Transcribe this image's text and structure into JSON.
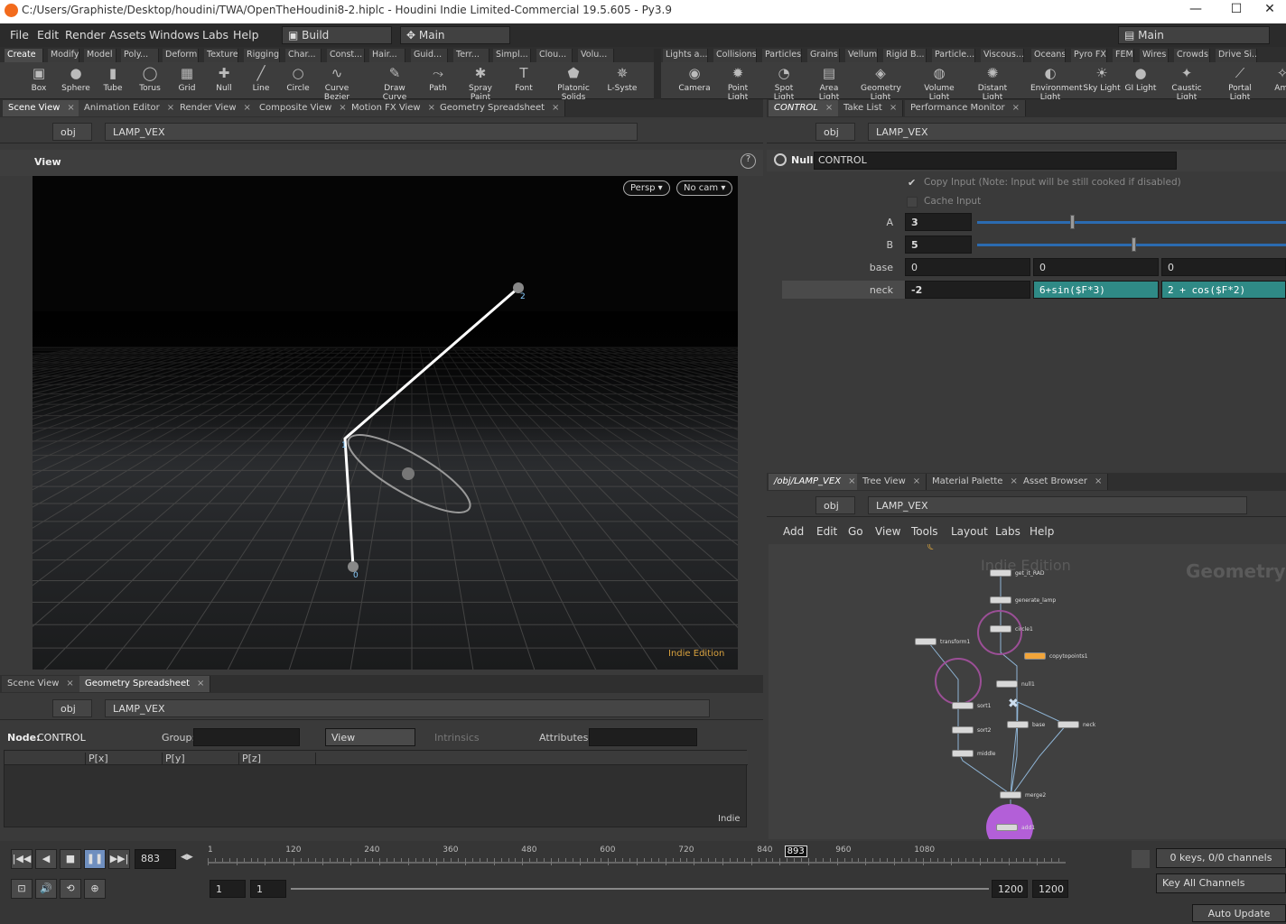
{
  "window": {
    "title": "C:/Users/Graphiste/Desktop/houdini/TWA/OpenTheHoudini8-2.hiplc - Houdini Indie Limited-Commercial 19.5.605 - Py3.9",
    "min": "—",
    "max": "☐",
    "close": "✕"
  },
  "menubar": {
    "items": [
      "File",
      "Edit",
      "Render",
      "Assets",
      "Windows",
      "Labs",
      "Help"
    ],
    "desktop": "Build",
    "context": "Main",
    "right_desktop": "Main"
  },
  "shelf_tabs_left": [
    "Create",
    "Modify",
    "Model",
    "Poly...",
    "Deform",
    "Texture",
    "Rigging",
    "Char...",
    "Const...",
    "Hair...",
    "Guid...",
    "Terr...",
    "Simpl...",
    "Clou...",
    "Volu..."
  ],
  "shelf_tabs_right": [
    "Lights a...",
    "Collisions",
    "Particles",
    "Grains",
    "Vellum",
    "Rigid B...",
    "Particle...",
    "Viscous...",
    "Oceans",
    "Pyro FX",
    "FEM",
    "Wires",
    "Crowds",
    "Drive Si..."
  ],
  "tools_left": [
    {
      "label": "Box",
      "icon": "▣"
    },
    {
      "label": "Sphere",
      "icon": "●"
    },
    {
      "label": "Tube",
      "icon": "▮"
    },
    {
      "label": "Torus",
      "icon": "◯"
    },
    {
      "label": "Grid",
      "icon": "▦"
    },
    {
      "label": "Null",
      "icon": "✚"
    },
    {
      "label": "Line",
      "icon": "╱"
    },
    {
      "label": "Circle",
      "icon": "○"
    },
    {
      "label": "Curve Bezier",
      "icon": "∿"
    },
    {
      "label": "Draw Curve",
      "icon": "✎"
    },
    {
      "label": "Path",
      "icon": "⤳"
    },
    {
      "label": "Spray Paint",
      "icon": "✱"
    },
    {
      "label": "Font",
      "icon": "T"
    },
    {
      "label": "Platonic Solids",
      "icon": "⬟"
    },
    {
      "label": "L-Syste",
      "icon": "✵"
    }
  ],
  "tools_right": [
    {
      "label": "Camera",
      "icon": "◉"
    },
    {
      "label": "Point Light",
      "icon": "✹"
    },
    {
      "label": "Spot Light",
      "icon": "◔"
    },
    {
      "label": "Area Light",
      "icon": "▤"
    },
    {
      "label": "Geometry Light",
      "icon": "◈"
    },
    {
      "label": "Volume Light",
      "icon": "◍"
    },
    {
      "label": "Distant Light",
      "icon": "✺"
    },
    {
      "label": "Environment Light",
      "icon": "◐"
    },
    {
      "label": "Sky Light",
      "icon": "☀"
    },
    {
      "label": "GI Light",
      "icon": "●"
    },
    {
      "label": "Caustic Light",
      "icon": "✦"
    },
    {
      "label": "Portal Light",
      "icon": "⟋"
    },
    {
      "label": "Ami",
      "icon": "✧"
    }
  ],
  "left_pane_tabs": [
    "Scene View",
    "Animation Editor",
    "Render View",
    "Composite View",
    "Motion FX View",
    "Geometry Spreadsheet"
  ],
  "path": {
    "root": "obj",
    "node": "LAMP_VEX"
  },
  "viewer": {
    "label": "View",
    "persp": "Persp ▾",
    "cam": "No cam ▾",
    "watermark": "Indie Edition",
    "points": [
      "0",
      "1",
      "2"
    ]
  },
  "bottom_left_tabs": [
    "Scene View",
    "Geometry Spreadsheet"
  ],
  "spreadsheet": {
    "node_label": "Node:",
    "node": "CONTROL",
    "group_label": "Group:",
    "view": "View",
    "intrinsics": "Intrinsics",
    "attributes": "Attributes:",
    "columns": [
      "P[x]",
      "P[y]",
      "P[z]"
    ],
    "watermark": "Indie"
  },
  "param_tabs": [
    "CONTROL",
    "Take List",
    "Performance Monitor"
  ],
  "params": {
    "type": "Null",
    "name": "CONTROL",
    "copy_input": "Copy Input (Note: Input will be still cooked if disabled)",
    "cache_input": "Cache Input",
    "a_label": "A",
    "a_value": "3",
    "a_level": 0.3,
    "b_label": "B",
    "b_value": "5",
    "b_level": 0.5,
    "base_label": "base",
    "base": [
      "0",
      "0",
      "0"
    ],
    "neck_label": "neck",
    "neck": [
      "-2",
      "6+sin($F*3)",
      "2 + cos($F*2)"
    ]
  },
  "net_tabs": [
    "/obj/LAMP_VEX",
    "Tree View",
    "Material Palette",
    "Asset Browser"
  ],
  "net_menu": [
    "Add",
    "Edit",
    "Go",
    "View",
    "Tools",
    "Layout",
    "Labs",
    "Help"
  ],
  "network": {
    "watermark": "Indie Edition",
    "context": "Geometry",
    "nodes": [
      "get_it_RAD",
      "generate_lamp",
      "circle1",
      "transform1",
      "copytopoints1",
      "null1",
      "sort1",
      "sort2",
      "middle",
      "base",
      "neck",
      "merge2",
      "add1"
    ]
  },
  "timeline": {
    "frame": "883",
    "marker": "893",
    "ticks": [
      "1",
      "120",
      "240",
      "360",
      "480",
      "600",
      "720",
      "840",
      "960",
      "1080"
    ],
    "start": "1",
    "start2": "1",
    "end": "1200",
    "end2": "1200",
    "keys": "0 keys, 0/0 channels",
    "key_all": "Key All Channels",
    "auto_update": "Auto Update"
  }
}
